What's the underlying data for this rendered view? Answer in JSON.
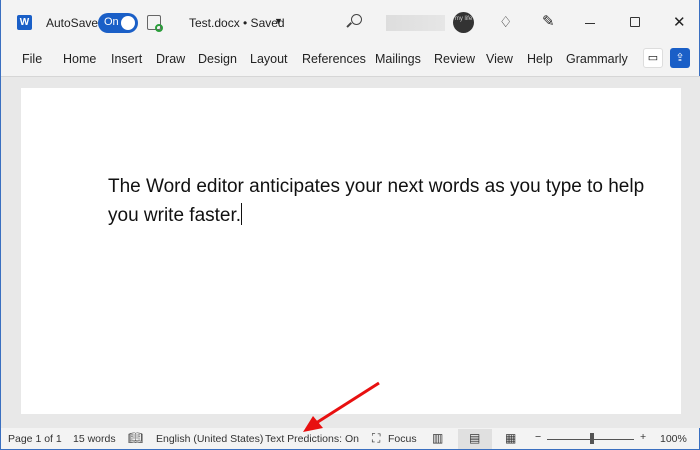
{
  "titlebar": {
    "autosave_label": "AutoSave",
    "autosave_state": "On",
    "document_title": "Test.docx • Saved",
    "avatar_text": "my life"
  },
  "ribbon": {
    "tabs": [
      "File",
      "Home",
      "Insert",
      "Draw",
      "Design",
      "Layout",
      "References",
      "Mailings",
      "Review",
      "View",
      "Help",
      "Grammarly"
    ]
  },
  "document": {
    "text": "The Word editor anticipates your next words as you type to help you write faster."
  },
  "statusbar": {
    "page": "Page 1 of 1",
    "words": "15 words",
    "language": "English (United States)",
    "text_predictions": "Text Predictions: On",
    "focus": "Focus",
    "zoom": "100%",
    "zoom_minus": "−",
    "zoom_plus": "+",
    "zoom_level_percent": 100
  },
  "colors": {
    "accent": "#1a5fc7",
    "arrow": "#e81010"
  }
}
